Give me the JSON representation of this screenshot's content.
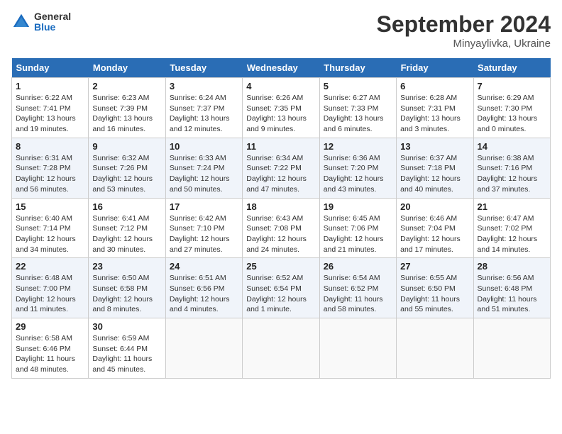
{
  "logo": {
    "general": "General",
    "blue": "Blue"
  },
  "title": "September 2024",
  "subtitle": "Minyaylivka, Ukraine",
  "days_of_week": [
    "Sunday",
    "Monday",
    "Tuesday",
    "Wednesday",
    "Thursday",
    "Friday",
    "Saturday"
  ],
  "weeks": [
    [
      {
        "day": "1",
        "info": "Sunrise: 6:22 AM\nSunset: 7:41 PM\nDaylight: 13 hours\nand 19 minutes."
      },
      {
        "day": "2",
        "info": "Sunrise: 6:23 AM\nSunset: 7:39 PM\nDaylight: 13 hours\nand 16 minutes."
      },
      {
        "day": "3",
        "info": "Sunrise: 6:24 AM\nSunset: 7:37 PM\nDaylight: 13 hours\nand 12 minutes."
      },
      {
        "day": "4",
        "info": "Sunrise: 6:26 AM\nSunset: 7:35 PM\nDaylight: 13 hours\nand 9 minutes."
      },
      {
        "day": "5",
        "info": "Sunrise: 6:27 AM\nSunset: 7:33 PM\nDaylight: 13 hours\nand 6 minutes."
      },
      {
        "day": "6",
        "info": "Sunrise: 6:28 AM\nSunset: 7:31 PM\nDaylight: 13 hours\nand 3 minutes."
      },
      {
        "day": "7",
        "info": "Sunrise: 6:29 AM\nSunset: 7:30 PM\nDaylight: 13 hours\nand 0 minutes."
      }
    ],
    [
      {
        "day": "8",
        "info": "Sunrise: 6:31 AM\nSunset: 7:28 PM\nDaylight: 12 hours\nand 56 minutes."
      },
      {
        "day": "9",
        "info": "Sunrise: 6:32 AM\nSunset: 7:26 PM\nDaylight: 12 hours\nand 53 minutes."
      },
      {
        "day": "10",
        "info": "Sunrise: 6:33 AM\nSunset: 7:24 PM\nDaylight: 12 hours\nand 50 minutes."
      },
      {
        "day": "11",
        "info": "Sunrise: 6:34 AM\nSunset: 7:22 PM\nDaylight: 12 hours\nand 47 minutes."
      },
      {
        "day": "12",
        "info": "Sunrise: 6:36 AM\nSunset: 7:20 PM\nDaylight: 12 hours\nand 43 minutes."
      },
      {
        "day": "13",
        "info": "Sunrise: 6:37 AM\nSunset: 7:18 PM\nDaylight: 12 hours\nand 40 minutes."
      },
      {
        "day": "14",
        "info": "Sunrise: 6:38 AM\nSunset: 7:16 PM\nDaylight: 12 hours\nand 37 minutes."
      }
    ],
    [
      {
        "day": "15",
        "info": "Sunrise: 6:40 AM\nSunset: 7:14 PM\nDaylight: 12 hours\nand 34 minutes."
      },
      {
        "day": "16",
        "info": "Sunrise: 6:41 AM\nSunset: 7:12 PM\nDaylight: 12 hours\nand 30 minutes."
      },
      {
        "day": "17",
        "info": "Sunrise: 6:42 AM\nSunset: 7:10 PM\nDaylight: 12 hours\nand 27 minutes."
      },
      {
        "day": "18",
        "info": "Sunrise: 6:43 AM\nSunset: 7:08 PM\nDaylight: 12 hours\nand 24 minutes."
      },
      {
        "day": "19",
        "info": "Sunrise: 6:45 AM\nSunset: 7:06 PM\nDaylight: 12 hours\nand 21 minutes."
      },
      {
        "day": "20",
        "info": "Sunrise: 6:46 AM\nSunset: 7:04 PM\nDaylight: 12 hours\nand 17 minutes."
      },
      {
        "day": "21",
        "info": "Sunrise: 6:47 AM\nSunset: 7:02 PM\nDaylight: 12 hours\nand 14 minutes."
      }
    ],
    [
      {
        "day": "22",
        "info": "Sunrise: 6:48 AM\nSunset: 7:00 PM\nDaylight: 12 hours\nand 11 minutes."
      },
      {
        "day": "23",
        "info": "Sunrise: 6:50 AM\nSunset: 6:58 PM\nDaylight: 12 hours\nand 8 minutes."
      },
      {
        "day": "24",
        "info": "Sunrise: 6:51 AM\nSunset: 6:56 PM\nDaylight: 12 hours\nand 4 minutes."
      },
      {
        "day": "25",
        "info": "Sunrise: 6:52 AM\nSunset: 6:54 PM\nDaylight: 12 hours\nand 1 minute."
      },
      {
        "day": "26",
        "info": "Sunrise: 6:54 AM\nSunset: 6:52 PM\nDaylight: 11 hours\nand 58 minutes."
      },
      {
        "day": "27",
        "info": "Sunrise: 6:55 AM\nSunset: 6:50 PM\nDaylight: 11 hours\nand 55 minutes."
      },
      {
        "day": "28",
        "info": "Sunrise: 6:56 AM\nSunset: 6:48 PM\nDaylight: 11 hours\nand 51 minutes."
      }
    ],
    [
      {
        "day": "29",
        "info": "Sunrise: 6:58 AM\nSunset: 6:46 PM\nDaylight: 11 hours\nand 48 minutes."
      },
      {
        "day": "30",
        "info": "Sunrise: 6:59 AM\nSunset: 6:44 PM\nDaylight: 11 hours\nand 45 minutes."
      },
      {
        "day": "",
        "info": ""
      },
      {
        "day": "",
        "info": ""
      },
      {
        "day": "",
        "info": ""
      },
      {
        "day": "",
        "info": ""
      },
      {
        "day": "",
        "info": ""
      }
    ]
  ]
}
